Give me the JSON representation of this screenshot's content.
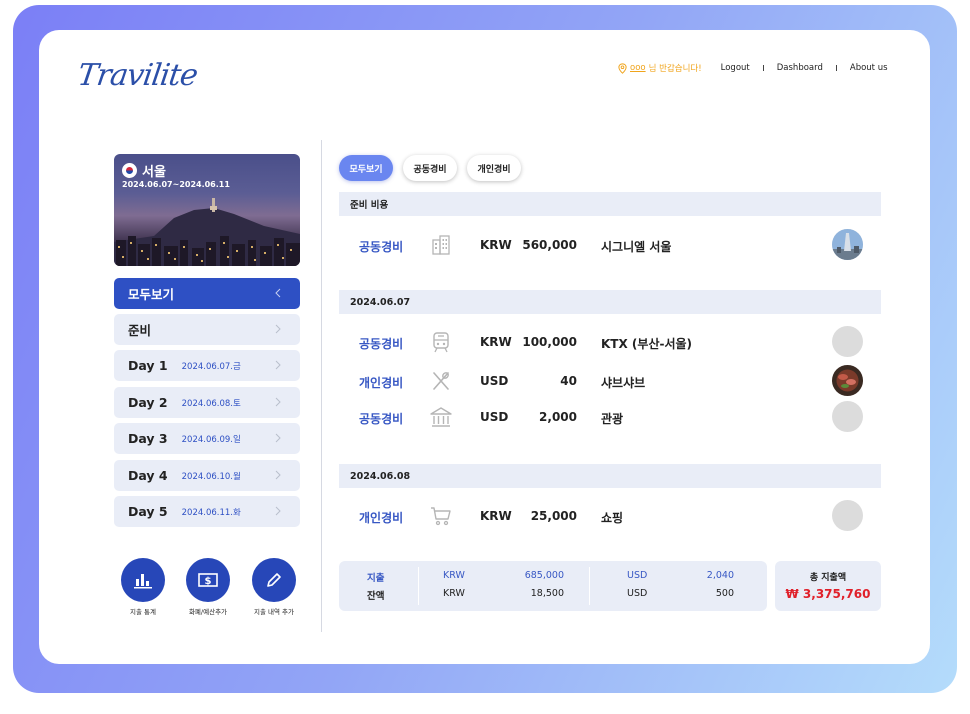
{
  "header": {
    "logo": "Travilite",
    "greeting_user": "ooo",
    "greeting_text": " 님 반갑습니다!",
    "nav": [
      "Logout",
      "Dashboard",
      "About us"
    ]
  },
  "sidebar": {
    "city": {
      "name": "서울",
      "dates": "2024.06.07~2024.06.11"
    },
    "menu": [
      {
        "label": "모두보기",
        "sub": ""
      },
      {
        "label": "준비",
        "sub": ""
      },
      {
        "label": "Day 1",
        "sub": "2024.06.07.금"
      },
      {
        "label": "Day 2",
        "sub": "2024.06.08.토"
      },
      {
        "label": "Day 3",
        "sub": "2024.06.09.일"
      },
      {
        "label": "Day 4",
        "sub": "2024.06.10.월"
      },
      {
        "label": "Day 5",
        "sub": "2024.06.11.화"
      }
    ],
    "actions": [
      "지출 통계",
      "화폐/예산추가",
      "지출 내역 추가"
    ]
  },
  "tabs": [
    "모두보기",
    "공동경비",
    "개인경비"
  ],
  "sections": [
    {
      "title": "준비 비용",
      "rows": [
        {
          "type": "공동경비",
          "icon": "building-icon",
          "currency": "KRW",
          "amount": "560,000",
          "desc": "시그니엘 서울",
          "thumb": "photo-tower"
        }
      ]
    },
    {
      "title": "2024.06.07",
      "rows": [
        {
          "type": "공동경비",
          "icon": "train-icon",
          "currency": "KRW",
          "amount": "100,000",
          "desc": "KTX (부산-서울)",
          "thumb": "none"
        },
        {
          "type": "개인경비",
          "icon": "utensils-icon",
          "currency": "USD",
          "amount": "40",
          "desc": "샤브샤브",
          "thumb": "photo-food"
        },
        {
          "type": "공동경비",
          "icon": "museum-icon",
          "currency": "USD",
          "amount": "2,000",
          "desc": "관광",
          "thumb": "none"
        }
      ]
    },
    {
      "title": "2024.06.08",
      "rows": [
        {
          "type": "개인경비",
          "icon": "cart-icon",
          "currency": "KRW",
          "amount": "25,000",
          "desc": "쇼핑",
          "thumb": "none"
        }
      ]
    }
  ],
  "summary": {
    "spent_label": "지출",
    "balance_label": "잔액",
    "spent": [
      {
        "currency": "KRW",
        "amount": "685,000"
      },
      {
        "currency": "USD",
        "amount": "2,040"
      }
    ],
    "balance": [
      {
        "currency": "KRW",
        "amount": "18,500"
      },
      {
        "currency": "USD",
        "amount": "500"
      }
    ],
    "total_label": "총 지출액",
    "total_value": "₩ 3,375,760"
  },
  "colors": {
    "accent": "#2e50c4",
    "light_bg": "#e9edf7",
    "greeting": "#f0a41c",
    "total": "#e0202a"
  }
}
